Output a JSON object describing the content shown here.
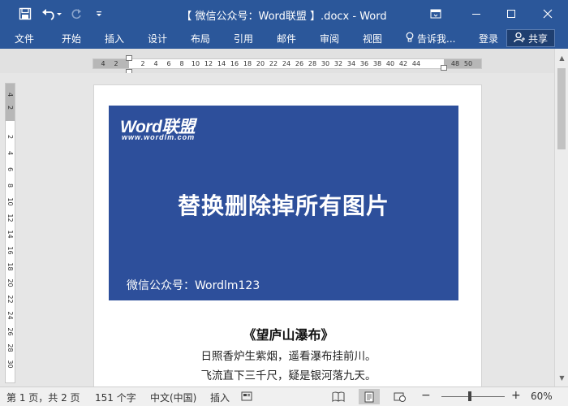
{
  "window": {
    "title": "【 微信公众号：Word联盟 】.docx - Word",
    "quick_access": {
      "save_icon": "save-icon",
      "undo_icon": "undo-icon",
      "redo_icon": "redo-icon",
      "customize_icon": "customize-qat-icon"
    }
  },
  "ribbon": {
    "tabs": [
      "文件",
      "开始",
      "插入",
      "设计",
      "布局",
      "引用",
      "邮件",
      "审阅",
      "视图"
    ],
    "tell_me": "告诉我...",
    "login": "登录",
    "share": "共享"
  },
  "ruler": {
    "horizontal_ticks": [
      "4",
      "2",
      "2",
      "4",
      "6",
      "8",
      "10",
      "12",
      "14",
      "16",
      "18",
      "20",
      "22",
      "24",
      "26",
      "28",
      "30",
      "32",
      "34",
      "36",
      "38",
      "40",
      "42",
      "44",
      "48",
      "50"
    ],
    "vertical_ticks": [
      "4",
      "2",
      "2",
      "4",
      "6",
      "8",
      "10",
      "12",
      "14",
      "16",
      "18",
      "20",
      "22",
      "24",
      "26",
      "28",
      "30"
    ]
  },
  "document": {
    "banner": {
      "logo": "Word联盟",
      "logo_url": "www.wordlm.com",
      "title": "替换删除掉所有图片",
      "subtitle": "微信公众号：Wordlm123",
      "color": "#2d4f9b"
    },
    "poem": {
      "title": "《望庐山瀑布》",
      "lines": [
        "日照香炉生紫烟，遥看瀑布挂前川。",
        "飞流直下三千尺，疑是银河落九天。"
      ]
    }
  },
  "status_bar": {
    "page": "第 1 页，共 2 页",
    "words": "151 个字",
    "language": "中文(中国)",
    "mode": "插入",
    "zoom": "60%",
    "zoom_value": 0.6
  },
  "colors": {
    "accent": "#2b579a",
    "share_bg": "#1f3f70",
    "status_bg": "#f0f0f0"
  }
}
